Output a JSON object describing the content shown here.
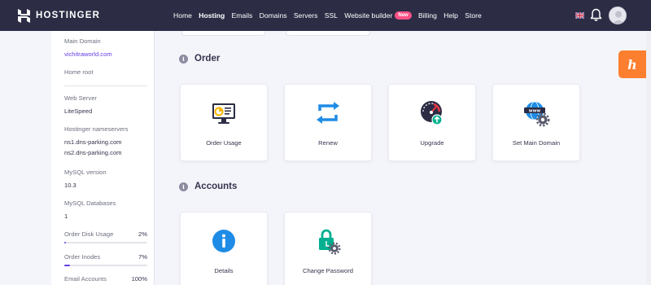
{
  "header": {
    "brand": "HOSTINGER",
    "nav": [
      {
        "label": "Home",
        "active": false
      },
      {
        "label": "Hosting",
        "active": true
      },
      {
        "label": "Emails",
        "active": false
      },
      {
        "label": "Domains",
        "active": false
      },
      {
        "label": "Servers",
        "active": false
      },
      {
        "label": "SSL",
        "active": false
      },
      {
        "label": "Website builder",
        "active": false,
        "badge": "New"
      },
      {
        "label": "Billing",
        "active": false
      },
      {
        "label": "Help",
        "active": false
      },
      {
        "label": "Store",
        "active": false
      }
    ],
    "icons": [
      "uk-flag-icon",
      "bell-icon",
      "avatar"
    ]
  },
  "sidebar": {
    "main_domain_label": "Main Domain",
    "main_domain_value": "vichitraworld.com",
    "home_root_label": "Home root",
    "web_server_label": "Web Server",
    "web_server_value": "LiteSpeed",
    "nameservers_label": "Hostinger nameservers",
    "nameserver_1": "ns1.dns-parking.com",
    "nameserver_2": "ns2.dns-parking.com",
    "mysql_version_label": "MySQL version",
    "mysql_version_value": "10.3",
    "mysql_databases_label": "MySQL Databases",
    "mysql_databases_value": "1",
    "disk_usage_label": "Order Disk Usage",
    "disk_usage_pct": "2%",
    "disk_usage_fraction": 0.02,
    "inodes_label": "Order Inodes",
    "inodes_pct": "7%",
    "inodes_fraction": 0.07,
    "email_accounts_label": "Email Accounts",
    "email_accounts_pct": "100%"
  },
  "sections": {
    "order": {
      "title": "Order",
      "cards": [
        {
          "label": "Order Usage",
          "icon": "order-usage-icon"
        },
        {
          "label": "Renew",
          "icon": "renew-icon"
        },
        {
          "label": "Upgrade",
          "icon": "upgrade-gauge-icon"
        },
        {
          "label": "Set Main Domain",
          "icon": "www-gear-icon"
        }
      ]
    },
    "accounts": {
      "title": "Accounts",
      "cards": [
        {
          "label": "Details",
          "icon": "info-icon"
        },
        {
          "label": "Change Password",
          "icon": "lock-gear-icon"
        }
      ]
    }
  },
  "colors": {
    "topbar": "#2c2d45",
    "accent": "#673de6",
    "help_button": "#fc7e2f",
    "renew_blue": "#1e8ce6",
    "green": "#00b090"
  }
}
